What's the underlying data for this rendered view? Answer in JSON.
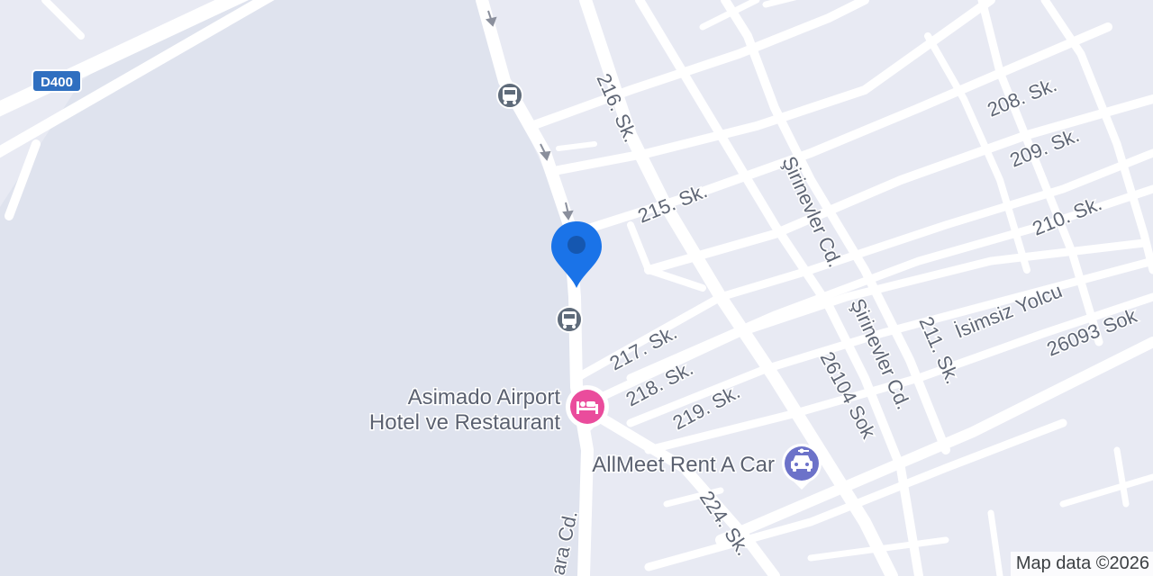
{
  "map": {
    "highway_shield": "D400",
    "attribution": "Map data ©2026",
    "streets": {
      "s216": "216. Sk.",
      "s208": "208. Sk.",
      "s209": "209. Sk.",
      "s215": "215. Sk.",
      "s210": "210. Sk.",
      "sirinevler1": "Şirinevler Cd.",
      "sirinevler2": "Şirinevler Cd.",
      "isimsiz": "İsimsiz Yolcu",
      "s217": "217. Sk.",
      "s218": "218. Sk.",
      "s219": "219. Sk.",
      "s211": "211. Sk.",
      "s26093": "26093 Sok",
      "s26104": "26104 Sok",
      "s224": "224. Sk.",
      "ankara": "ara Cd."
    },
    "pois": {
      "hotel_line1": "Asimado Airport",
      "hotel_line2": "Hotel ve Restaurant",
      "rental": "AllMeet Rent A Car"
    },
    "colors": {
      "background": "#e8eaf3",
      "water_area": "#dfe3ee",
      "road": "#ffffff",
      "pin": "#1a73e8",
      "hotel": "#ea4c9c",
      "rental": "#6c72c9",
      "shield": "#2f6fc0",
      "transit": "#5f6b7a"
    },
    "icons": [
      "location-pin-icon",
      "bus-stop-icon",
      "hotel-icon",
      "car-rental-icon",
      "highway-shield-icon",
      "one-way-arrow-icon"
    ]
  }
}
